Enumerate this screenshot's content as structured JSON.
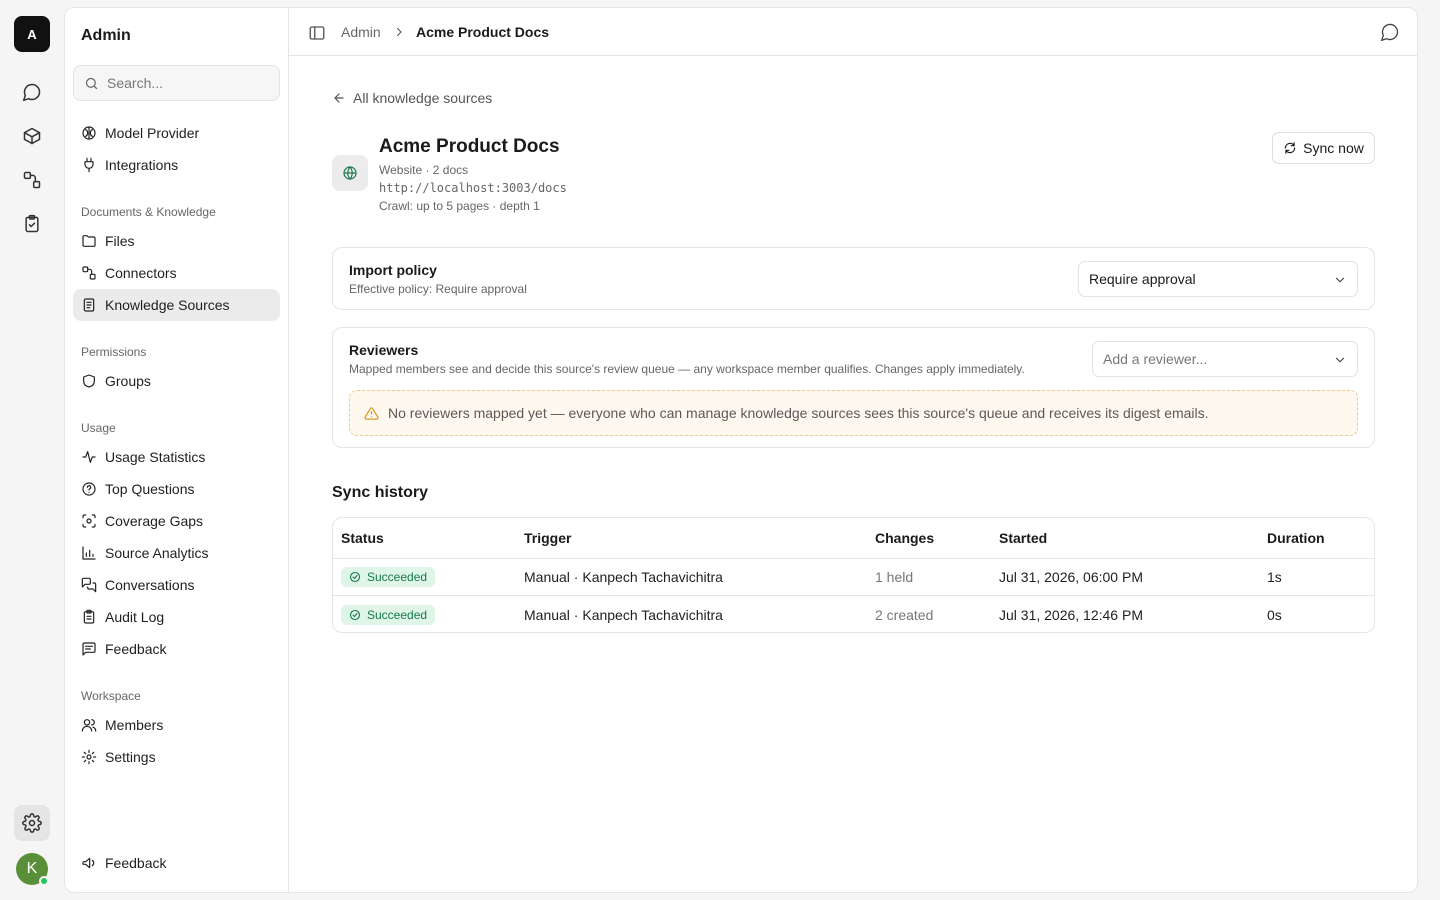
{
  "rail": {
    "logo_letter": "A",
    "avatar_letter": "K"
  },
  "sidebar": {
    "title": "Admin",
    "search_placeholder": "Search...",
    "items_top": [
      {
        "label": "Model Provider",
        "icon": "brain-icon"
      },
      {
        "label": "Integrations",
        "icon": "plug-icon"
      }
    ],
    "section_docs": "Documents & Knowledge",
    "items_docs": [
      {
        "label": "Files",
        "icon": "folder-icon"
      },
      {
        "label": "Connectors",
        "icon": "connector-icon"
      },
      {
        "label": "Knowledge Sources",
        "icon": "book-icon"
      }
    ],
    "section_permissions": "Permissions",
    "items_permissions": [
      {
        "label": "Groups",
        "icon": "shield-icon"
      }
    ],
    "section_usage": "Usage",
    "items_usage": [
      {
        "label": "Usage Statistics",
        "icon": "activity-icon"
      },
      {
        "label": "Top Questions",
        "icon": "question-icon"
      },
      {
        "label": "Coverage Gaps",
        "icon": "scan-icon"
      },
      {
        "label": "Source Analytics",
        "icon": "bar-chart-icon"
      },
      {
        "label": "Conversations",
        "icon": "messages-icon"
      },
      {
        "label": "Audit Log",
        "icon": "clipboard-icon"
      },
      {
        "label": "Feedback",
        "icon": "message-square-icon"
      }
    ],
    "section_workspace": "Workspace",
    "items_workspace": [
      {
        "label": "Members",
        "icon": "users-icon"
      },
      {
        "label": "Settings",
        "icon": "gear-icon"
      }
    ],
    "footer_feedback": "Feedback"
  },
  "header": {
    "breadcrumb_root": "Admin",
    "breadcrumb_current": "Acme Product Docs"
  },
  "source": {
    "back_label": "All knowledge sources",
    "name": "Acme Product Docs",
    "meta": "Website · 2 docs",
    "url": "http://localhost:3003/docs",
    "crawl": "Crawl: up to 5 pages · depth 1",
    "sync_label": "Sync now"
  },
  "import_policy": {
    "title": "Import policy",
    "subtitle": "Effective policy: Require approval",
    "selected": "Require approval"
  },
  "reviewers": {
    "title": "Reviewers",
    "subtitle": "Mapped members see and decide this source's review queue — any workspace member qualifies. Changes apply immediately.",
    "placeholder": "Add a reviewer...",
    "warning": "No reviewers mapped yet — everyone who can manage knowledge sources sees this source's queue and receives its digest emails."
  },
  "history": {
    "title": "Sync history",
    "columns": [
      "Status",
      "Trigger",
      "Changes",
      "Started",
      "Duration"
    ],
    "rows": [
      {
        "status": "Succeeded",
        "trigger": "Manual · Kanpech Tachavichitra",
        "changes": "1 held",
        "started": "Jul 31, 2026, 06:00 PM",
        "duration": "1s"
      },
      {
        "status": "Succeeded",
        "trigger": "Manual · Kanpech Tachavichitra",
        "changes": "2 created",
        "started": "Jul 31, 2026, 12:46 PM",
        "duration": "0s"
      }
    ]
  },
  "colors": {
    "success_bg": "#dff5e6",
    "success_text": "#16794a",
    "warning_border": "#f0c98a",
    "warning_bg": "#fff8ee"
  }
}
